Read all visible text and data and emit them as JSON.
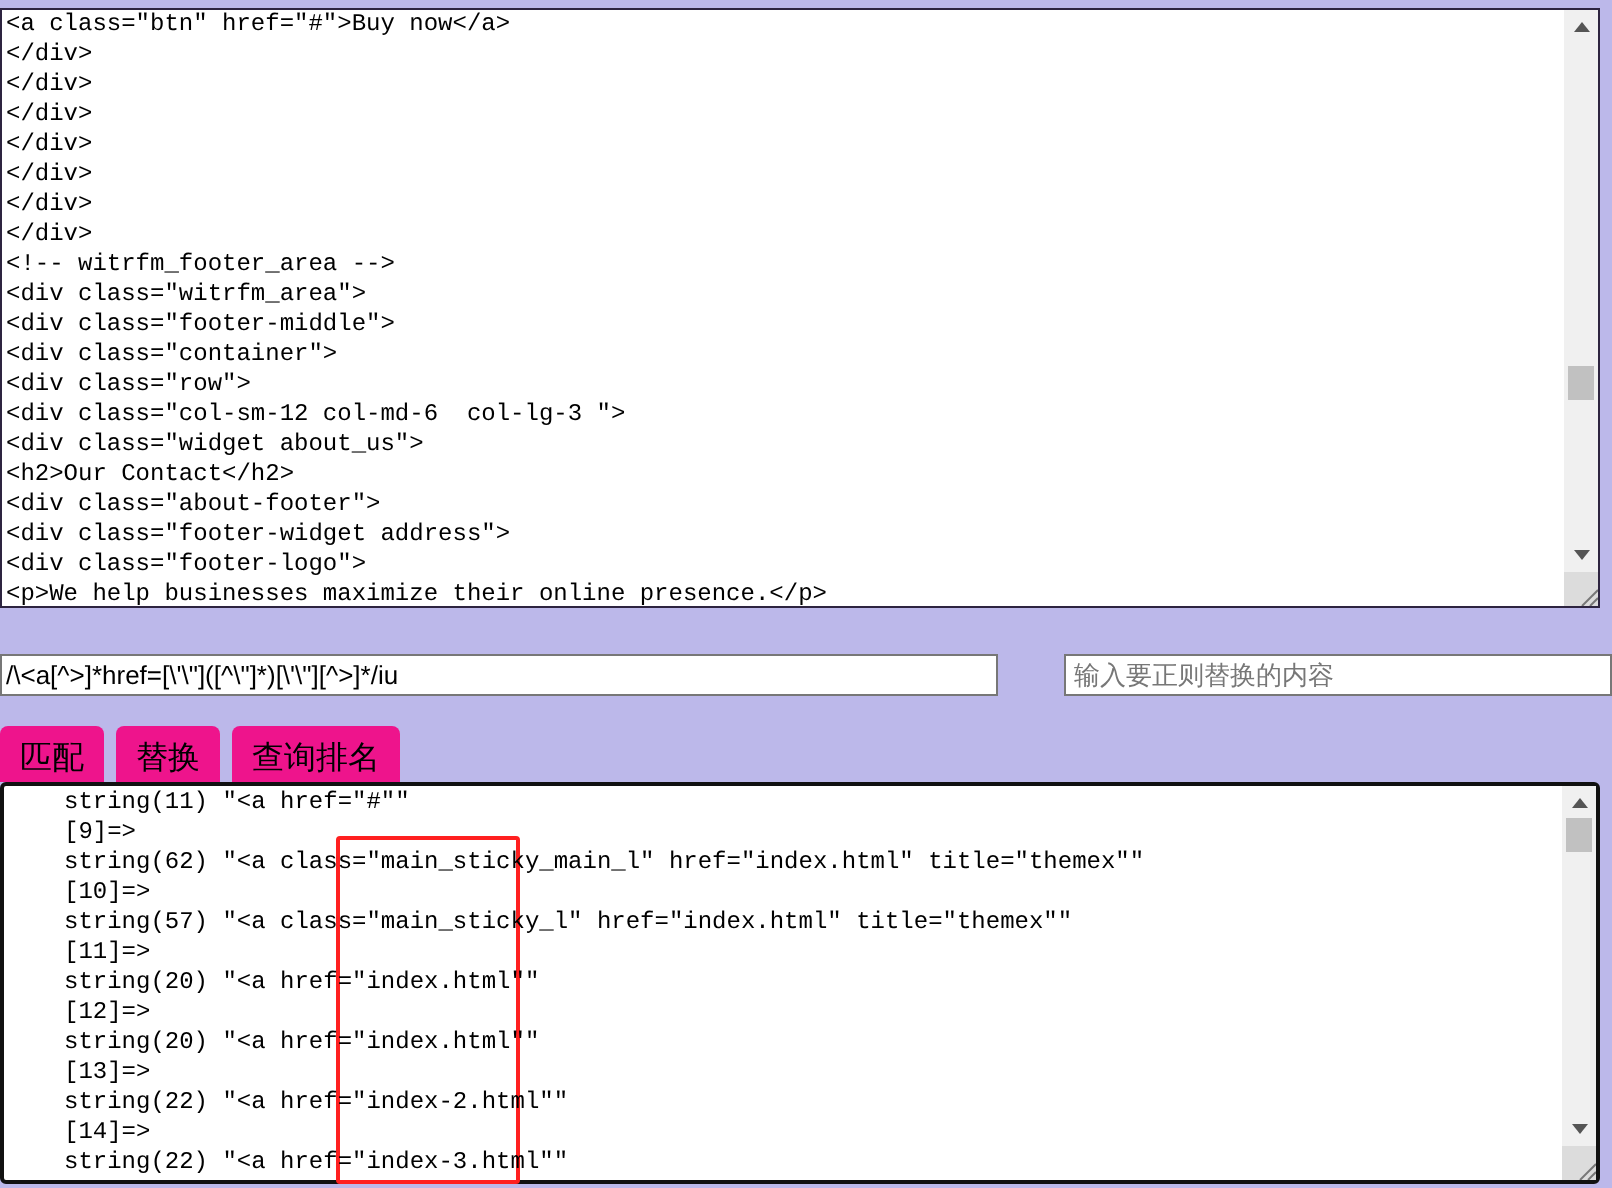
{
  "source_box": {
    "lines": [
      "<a class=\"btn\" href=\"#\">Buy now</a>",
      "</div>",
      "</div>",
      "</div>",
      "</div>",
      "</div>",
      "</div>",
      "</div>",
      "<!-- witrfm_footer_area -->",
      "<div class=\"witrfm_area\">",
      "<div class=\"footer-middle\">",
      "<div class=\"container\">",
      "<div class=\"row\">",
      "<div class=\"col-sm-12 col-md-6  col-lg-3 \">",
      "<div class=\"widget about_us\">",
      "<h2>Our Contact</h2>",
      "<div class=\"about-footer\">",
      "<div class=\"footer-widget address\">",
      "<div class=\"footer-logo\">",
      "<p>We help businesses maximize their online presence.</p>"
    ]
  },
  "regex_field": {
    "value": "/\\<a[^>]*href=[\\'\\\"]([^\\\"]*)[\\'\\\"][^>]*/iu"
  },
  "replace_field": {
    "placeholder": "输入要正则替换的内容"
  },
  "buttons": [
    "匹配",
    "替换",
    "查询排名"
  ],
  "results_box": {
    "lines": [
      "string(11) \"<a href=\"#\"\"",
      "[9]=>",
      "string(62) \"<a class=\"main_sticky_main_l\" href=\"index.html\" title=\"themex\"\"",
      "[10]=>",
      "string(57) \"<a class=\"main_sticky_l\" href=\"index.html\" title=\"themex\"\"",
      "[11]=>",
      "string(20) \"<a href=\"index.html\"\"",
      "[12]=>",
      "string(20) \"<a href=\"index.html\"\"",
      "[13]=>",
      "string(22) \"<a href=\"index-2.html\"\"",
      "[14]=>",
      "string(22) \"<a href=\"index-3.html\"\""
    ]
  }
}
